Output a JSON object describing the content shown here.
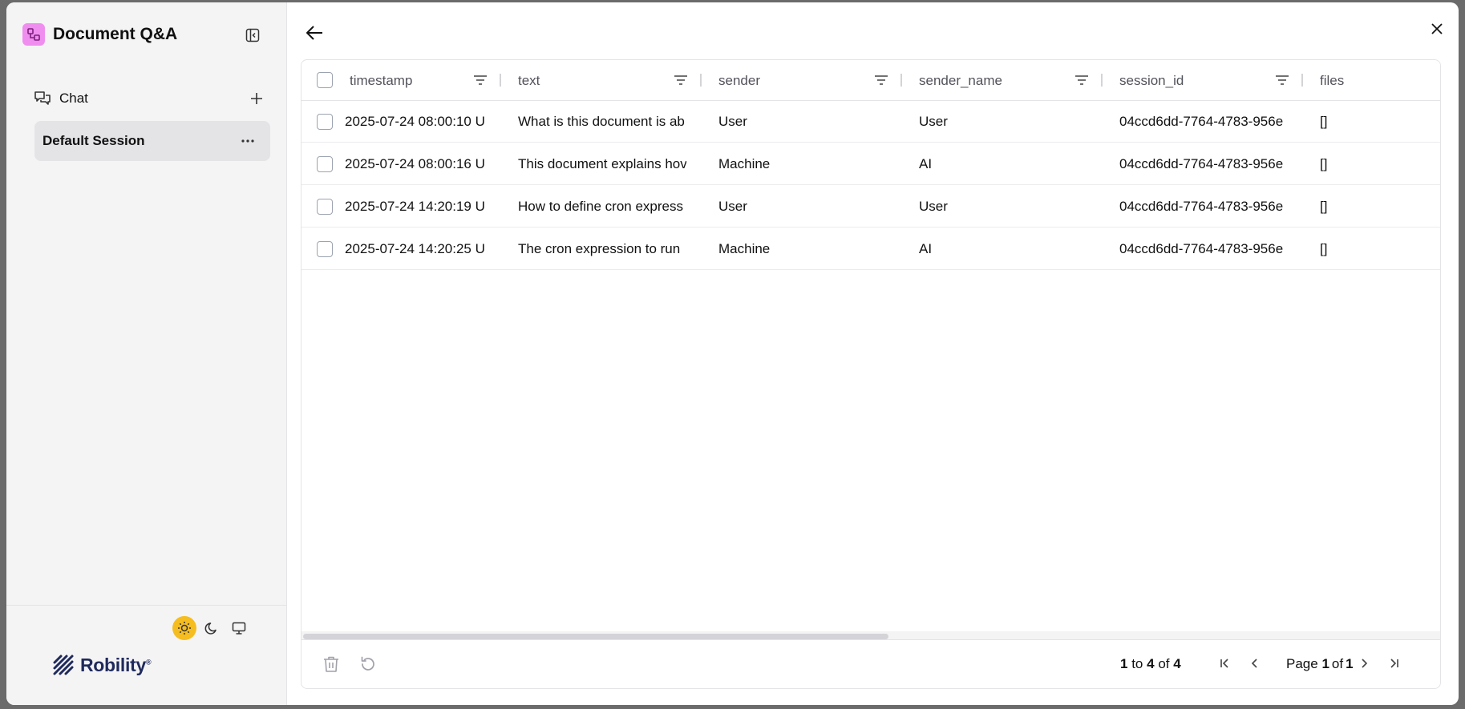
{
  "sidebar": {
    "title": "Document Q&A",
    "chat_label": "Chat",
    "session_label": "Default Session",
    "brand_footer": "Robility",
    "brand_footer_mark": "®"
  },
  "colors": {
    "brand_logo": "#f08ef0",
    "theme_active": "#f5bd1f",
    "sidebar_bg": "#f4f4f5",
    "footer_brand": "#1f2a5c"
  },
  "table": {
    "columns": [
      "timestamp",
      "text",
      "sender",
      "sender_name",
      "session_id",
      "files"
    ],
    "rows": [
      {
        "timestamp": "2025-07-24 08:00:10 U",
        "text": "What is this document is ab",
        "sender": "User",
        "sender_name": "User",
        "session_id": "04ccd6dd-7764-4783-956e",
        "files": "[]"
      },
      {
        "timestamp": "2025-07-24 08:00:16 U",
        "text": "This document explains hov",
        "sender": "Machine",
        "sender_name": "AI",
        "session_id": "04ccd6dd-7764-4783-956e",
        "files": "[]"
      },
      {
        "timestamp": "2025-07-24 14:20:19 U",
        "text": "How to define cron express",
        "sender": "User",
        "sender_name": "User",
        "session_id": "04ccd6dd-7764-4783-956e",
        "files": "[]"
      },
      {
        "timestamp": "2025-07-24 14:20:25 U",
        "text": "The cron expression to run",
        "sender": "Machine",
        "sender_name": "AI",
        "session_id": "04ccd6dd-7764-4783-956e",
        "files": "[]"
      }
    ]
  },
  "pager": {
    "from": "1",
    "to_word": "to",
    "to": "4",
    "of_word": "of",
    "total": "4",
    "page_word": "Page",
    "page": "1",
    "page_of_word": "of",
    "page_total": "1"
  },
  "icons": {
    "back": "arrow-left-icon",
    "close": "close-icon",
    "collapse": "panel-left-icon",
    "chat": "messages-icon",
    "add": "plus-icon",
    "more": "ellipsis-icon",
    "filter": "filter-icon",
    "delete": "trash-icon",
    "refresh": "refresh-icon",
    "sun": "sun-icon",
    "moon": "moon-icon",
    "monitor": "monitor-icon"
  }
}
